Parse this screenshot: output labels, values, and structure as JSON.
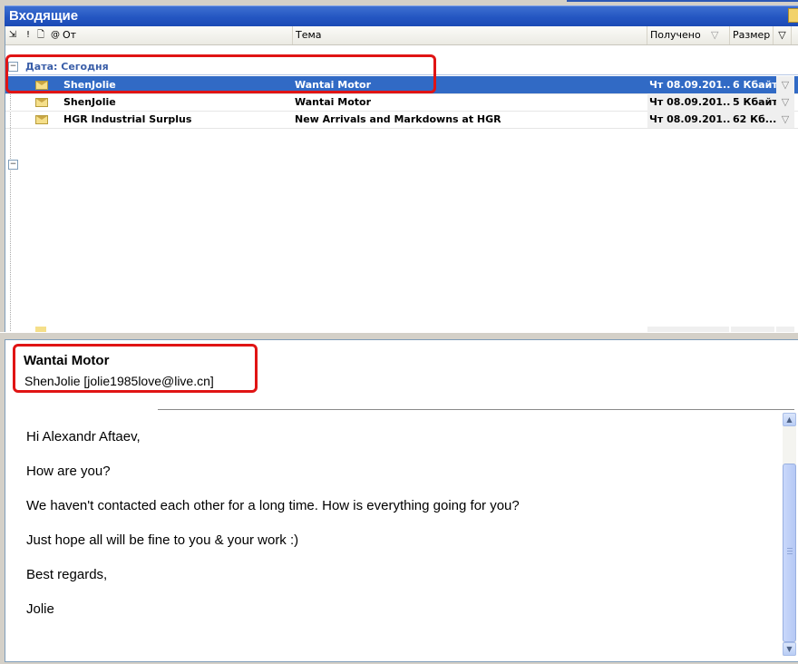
{
  "window": {
    "title": "Входящие"
  },
  "columns": {
    "icon_sort": "⇲",
    "importance": "!",
    "doc_type": "🗋",
    "attachment": "@",
    "from": "От",
    "subject": "Тема",
    "received": "Получено",
    "received_sort": "▽",
    "size": "Размер",
    "flag": "▽"
  },
  "group": {
    "label": "Дата: Сегодня",
    "toggle": "−"
  },
  "messages": [
    {
      "from": "ShenJolie",
      "subject": "Wantai Motor",
      "received": "Чт 08.09.201...",
      "size": "6 Кбайт",
      "flag": "▽",
      "selected": true
    },
    {
      "from": "ShenJolie",
      "subject": "Wantai Motor",
      "received": "Чт 08.09.201...",
      "size": "5 Кбайт",
      "flag": "▽",
      "selected": false
    },
    {
      "from": "HGR Industrial Surplus",
      "subject": "New Arrivals and Markdowns at HGR",
      "received": "Чт 08.09.201...",
      "size": "62 Кб...",
      "flag": "▽",
      "selected": false
    }
  ],
  "second_group_toggle": "−",
  "preview": {
    "subject": "Wantai Motor",
    "sender": "ShenJolie [jolie1985love@live.cn]",
    "body": [
      "Hi Alexandr Aftaev,",
      "How are you?",
      "We haven't contacted each other for a long time. How is everything going for you?",
      "Just hope all will be fine to you & your work :)",
      "Best regards,",
      "Jolie"
    ],
    "scroll_up": "▲",
    "scroll_down": "▼"
  }
}
